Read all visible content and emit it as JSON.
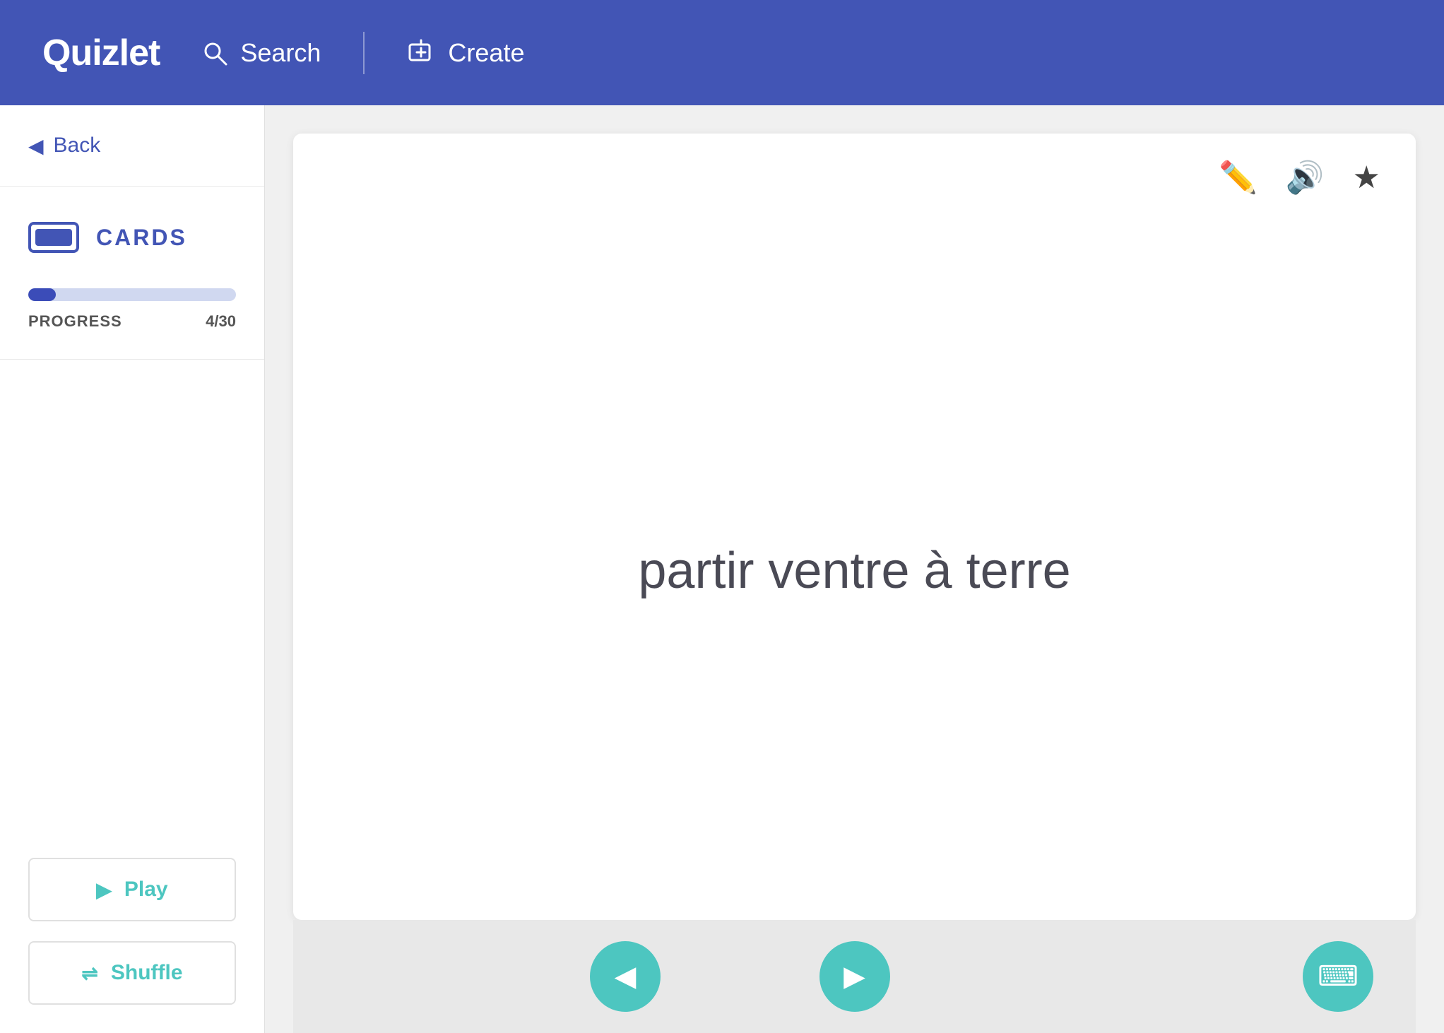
{
  "header": {
    "logo": "Quizlet",
    "search_label": "Search",
    "create_label": "Create"
  },
  "sidebar": {
    "back_label": "Back",
    "mode_label": "CARDS",
    "progress_label": "PROGRESS",
    "progress_current": 4,
    "progress_total": 30,
    "progress_text": "4/30",
    "progress_percent": 13.33,
    "play_label": "Play",
    "shuffle_label": "Shuffle"
  },
  "card": {
    "content": "partir ventre à terre"
  },
  "nav": {
    "prev_label": "◀",
    "next_label": "▶",
    "keyboard_label": "⌨"
  }
}
